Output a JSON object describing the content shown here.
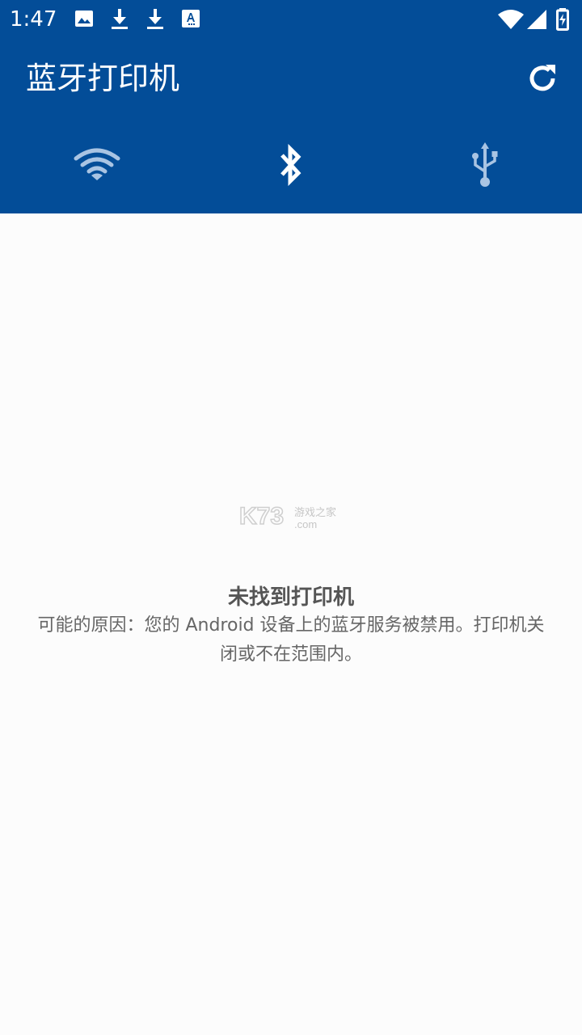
{
  "status_bar": {
    "time": "1:47",
    "notification_icons": [
      "image-icon",
      "download-icon",
      "download-icon",
      "translate-icon"
    ],
    "system_icons": [
      "wifi-signal-icon",
      "cell-signal-icon",
      "battery-charging-icon"
    ]
  },
  "app_bar": {
    "title": "蓝牙打印机",
    "action_icon": "refresh-icon"
  },
  "tabs": [
    {
      "icon": "wifi-icon",
      "selected": false
    },
    {
      "icon": "bluetooth-icon",
      "selected": true
    },
    {
      "icon": "usb-icon",
      "selected": false
    }
  ],
  "empty_state": {
    "title": "未找到打印机",
    "message": "可能的原因：您的 Android 设备上的蓝牙服务被禁用。打印机关闭或不在范围内。"
  },
  "watermark": {
    "logo": "K73",
    "tagline": "游戏之家",
    "domain": ".com"
  },
  "colors": {
    "primary": "#034d98",
    "background": "#fcfcfc",
    "inactive_icon": "#a9c4e3",
    "text": "#555555"
  }
}
